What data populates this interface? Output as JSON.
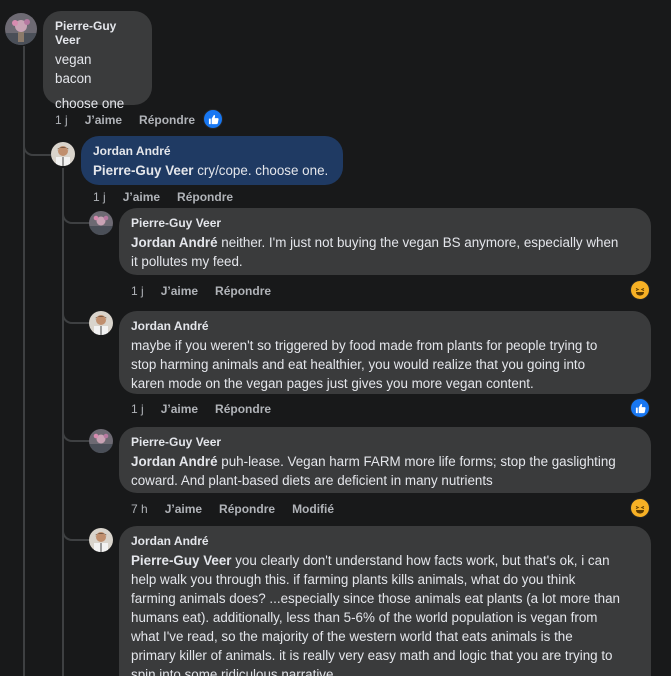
{
  "colors": {
    "background": "#18191a",
    "bubble": "#3a3b3c",
    "highlight_bubble": "#1f3a63",
    "like_blue": "#1877f2",
    "haha_yellow": "#f7b125",
    "secondary_text": "#b0b3b8"
  },
  "comments": [
    {
      "author": "Pierre-Guy Veer",
      "lines": [
        "vegan",
        "bacon",
        "",
        "choose one"
      ],
      "time": "1 j",
      "like_label": "J’aime",
      "reply_label": "Répondre",
      "reaction_icon": "like-icon"
    },
    {
      "author": "Jordan André",
      "mention": "Pierre-Guy Veer",
      "text": " cry/cope. choose one.",
      "time": "1 j",
      "like_label": "J’aime",
      "reply_label": "Répondre"
    },
    {
      "author": "Pierre-Guy Veer",
      "mention": "Jordan André",
      "line1": " neither. I'm just not buying the vegan BS anymore, especially when",
      "line2": "it pollutes my feed.",
      "time": "1 j",
      "like_label": "J’aime",
      "reply_label": "Répondre",
      "reaction_icon": "haha-icon"
    },
    {
      "author": "Jordan André",
      "lines": [
        "maybe if you weren't so triggered by food made from plants for people trying to",
        "stop harming animals and eat healthier, you would realize that you going into",
        "karen mode on the vegan pages just gives you more vegan content."
      ],
      "time": "1 j",
      "like_label": "J’aime",
      "reply_label": "Répondre",
      "reaction_icon": "like-icon"
    },
    {
      "author": "Pierre-Guy Veer",
      "mention": "Jordan André",
      "line1": " puh-lease. Vegan harm FARM more life forms; stop the gaslighting",
      "line2": "coward. And plant-based diets are deficient in many nutrients",
      "time": "7 h",
      "like_label": "J’aime",
      "reply_label": "Répondre",
      "edited_label": "Modifié",
      "reaction_icon": "haha-icon"
    },
    {
      "author": "Jordan André",
      "mention": "Pierre-Guy Veer",
      "line1": " you clearly don't understand how facts work, but that's ok, i can",
      "lines": [
        "help walk you through this. if farming plants kills animals, what do you think",
        "farming animals does? ...especially since those animals eat plants (a lot more than",
        "humans eat). additionally, less than 5-6% of the world population is vegan from",
        "what I've read, so the majority of the western world that eats animals is the",
        "primary killer of animals. it is really very easy math and logic that you are trying to",
        "spin into some ridiculous narrative."
      ]
    }
  ]
}
